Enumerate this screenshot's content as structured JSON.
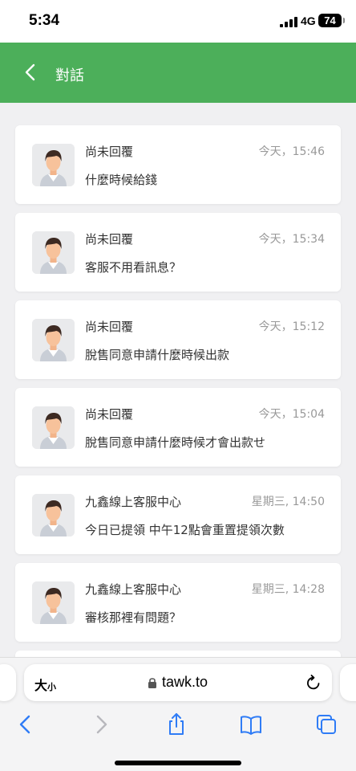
{
  "status_bar": {
    "time": "5:34",
    "network": "4G",
    "battery": "74"
  },
  "header": {
    "title": "對話"
  },
  "conversations": [
    {
      "name": "尚未回覆",
      "time": "今天，15:46",
      "message": "什麼時候給錢"
    },
    {
      "name": "尚未回覆",
      "time": "今天，15:34",
      "message": "客服不用看訊息？"
    },
    {
      "name": "尚未回覆",
      "time": "今天，15:12",
      "message": "脫售同意申請什麼時候出款"
    },
    {
      "name": "尚未回覆",
      "time": "今天，15:04",
      "message": "脫售同意申請什麼時候才會出款せ"
    },
    {
      "name": "九鑫線上客服中心",
      "time": "星期三, 14:50",
      "message": "今日已提領 中午12點會重置提領次數"
    },
    {
      "name": "九鑫線上客服中心",
      "time": "星期三, 14:28",
      "message": "審核那裡有問題？"
    }
  ],
  "browser": {
    "text_size_big": "大",
    "text_size_small": "小",
    "domain": "tawk.to"
  },
  "colors": {
    "header_green": "#4caf5a",
    "safari_blue": "#2f7cf6"
  }
}
